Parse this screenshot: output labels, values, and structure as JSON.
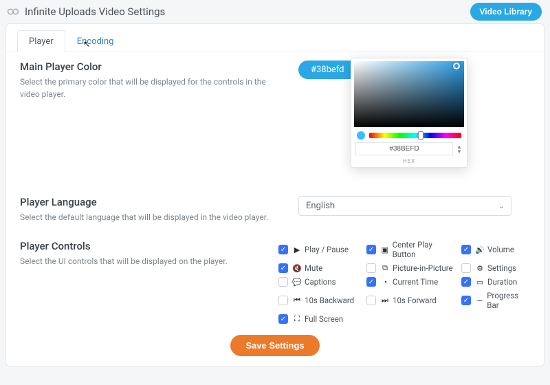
{
  "header": {
    "title": "Infinite Uploads Video Settings",
    "library_button": "Video Library"
  },
  "tabs": {
    "player": "Player",
    "encoding": "Encoding"
  },
  "color_section": {
    "heading": "Main Player Color",
    "desc": "Select the primary color that will be displayed for the controls in the video player.",
    "swatch_label": "#38befd",
    "hex_value": "#38BEFD",
    "hex_caption": "HEX"
  },
  "language_section": {
    "heading": "Player Language",
    "desc": "Select the default language that will be displayed in the video player.",
    "selected": "English"
  },
  "controls_section": {
    "heading": "Player Controls",
    "desc": "Select the UI controls that will be displayed on the player.",
    "items": [
      {
        "label": "Play / Pause",
        "checked": true
      },
      {
        "label": "Center Play Button",
        "checked": true
      },
      {
        "label": "Volume",
        "checked": true
      },
      {
        "label": "Mute",
        "checked": true
      },
      {
        "label": "Picture-in-Picture",
        "checked": false
      },
      {
        "label": "Settings",
        "checked": false
      },
      {
        "label": "Captions",
        "checked": false
      },
      {
        "label": "Current Time",
        "checked": true
      },
      {
        "label": "Duration",
        "checked": true
      },
      {
        "label": "10s Backward",
        "checked": false
      },
      {
        "label": "10s Forward",
        "checked": false
      },
      {
        "label": "Progress Bar",
        "checked": true
      },
      {
        "label": "Full Screen",
        "checked": true
      }
    ]
  },
  "save_button": "Save Settings",
  "colors": {
    "accent": "#2aa8e6",
    "action": "#ec7a2b",
    "check": "#3672f8"
  }
}
